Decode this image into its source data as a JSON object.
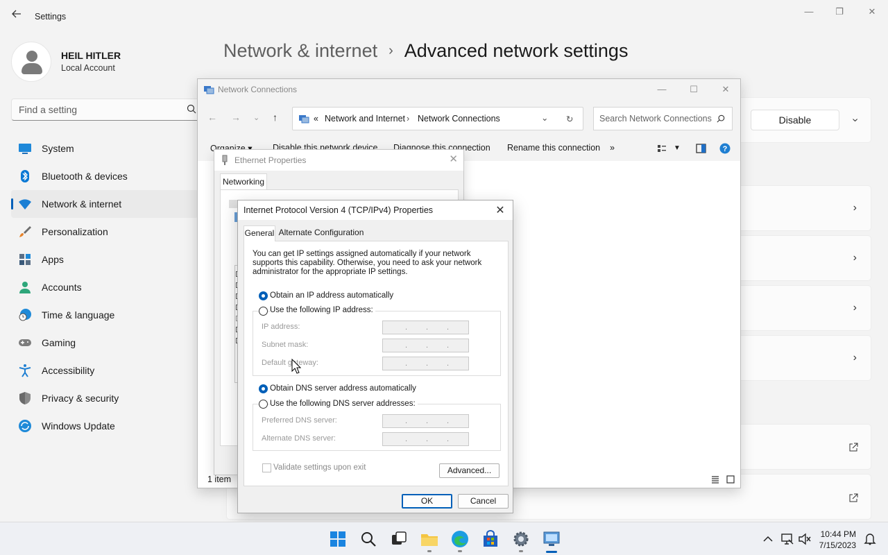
{
  "settings": {
    "app_title": "Settings",
    "profile": {
      "name": "HEIL HITLER",
      "subtitle": "Local Account"
    },
    "search": {
      "placeholder": "Find a setting"
    },
    "nav": [
      {
        "label": "System",
        "icon": "system-icon"
      },
      {
        "label": "Bluetooth & devices",
        "icon": "bluetooth-icon"
      },
      {
        "label": "Network & internet",
        "icon": "wifi-icon",
        "active": true
      },
      {
        "label": "Personalization",
        "icon": "brush-icon"
      },
      {
        "label": "Apps",
        "icon": "apps-icon"
      },
      {
        "label": "Accounts",
        "icon": "accounts-icon"
      },
      {
        "label": "Time & language",
        "icon": "clock-globe-icon"
      },
      {
        "label": "Gaming",
        "icon": "gamepad-icon"
      },
      {
        "label": "Accessibility",
        "icon": "accessibility-icon"
      },
      {
        "label": "Privacy & security",
        "icon": "shield-icon"
      },
      {
        "label": "Windows Update",
        "icon": "update-icon"
      }
    ],
    "breadcrumb": {
      "parent": "Network & internet",
      "separator": "›",
      "current": "Advanced network settings"
    },
    "disable_label": "Disable",
    "accent": "#005fb8"
  },
  "netconn": {
    "title": "Network Connections",
    "address": {
      "prefix": "«",
      "segments": [
        "Network and Internet",
        "Network Connections"
      ]
    },
    "search_placeholder": "Search Network Connections",
    "toolbar": [
      "Organize ▾",
      "Disable this network device",
      "Diagnose this connection",
      "Rename this connection",
      "»"
    ],
    "status": "1 item"
  },
  "ethernet": {
    "title": "Ethernet Properties",
    "tab": "Networking"
  },
  "ipv4": {
    "title": "Internet Protocol Version 4 (TCP/IPv4) Properties",
    "tabs": [
      "General",
      "Alternate Configuration"
    ],
    "description": "You can get IP settings assigned automatically if your network supports this capability. Otherwise, you need to ask your network administrator for the appropriate IP settings.",
    "ip_auto": "Obtain an IP address automatically",
    "ip_manual": "Use the following IP address:",
    "ip_fields": [
      "IP address:",
      "Subnet mask:",
      "Default gateway:"
    ],
    "dns_auto": "Obtain DNS server address automatically",
    "dns_manual": "Use the following DNS server addresses:",
    "dns_fields": [
      "Preferred DNS server:",
      "Alternate DNS server:"
    ],
    "validate": "Validate settings upon exit",
    "advanced": "Advanced...",
    "ok": "OK",
    "cancel": "Cancel"
  },
  "taskbar": {
    "time": "10:44 PM",
    "date": "7/15/2023"
  }
}
